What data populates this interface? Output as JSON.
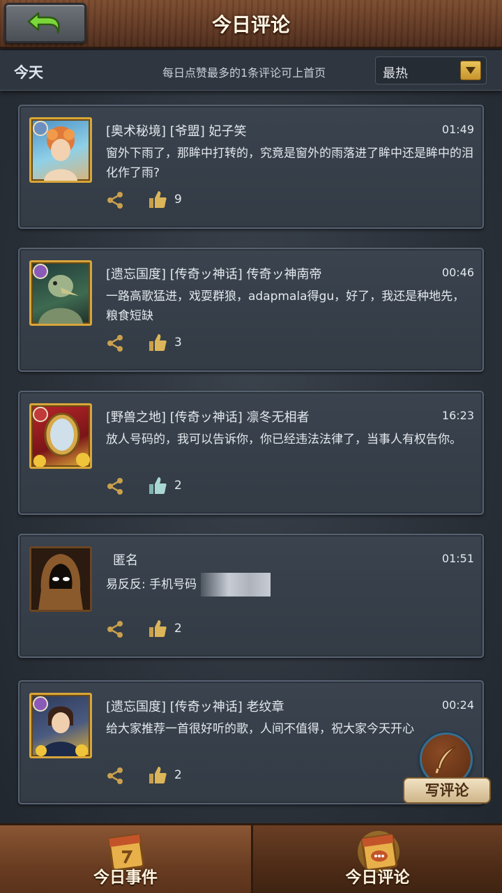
{
  "header": {
    "title": "今日评论",
    "back_icon": "back-arrow-icon"
  },
  "subbar": {
    "today_label": "今天",
    "hint": "每日点赞最多的1条评论可上首页",
    "sort": {
      "selected": "最热"
    }
  },
  "comments": [
    {
      "meta": "[奥术秘境] [爷盟] 妃子笑",
      "time": "01:49",
      "text": "窗外下雨了，那眸中打转的，究竟是窗外的雨落进了眸中还是眸中的泪化作了雨?",
      "likes": "9"
    },
    {
      "meta": "[遗忘国度] [传奇ッ神话] 传奇ッ神南帝",
      "time": "00:46",
      "text": "一路高歌猛进，戏耍群狼，adapmala得gu，好了，我还是种地先，粮食短缺",
      "likes": "3"
    },
    {
      "meta": "[野兽之地] [传奇ッ神话] 凛冬无相者",
      "time": "16:23",
      "text": "放人号码的，我可以告诉你，你已经违法法律了，当事人有权告你。",
      "likes": "2"
    },
    {
      "meta": "匿名",
      "time": "01:51",
      "text": "易反反: 手机号码",
      "likes": "2"
    },
    {
      "meta": "[遗忘国度] [传奇ッ神话] 老纹章",
      "time": "00:24",
      "text": "给大家推荐一首很好听的歌，人间不值得，祝大家今天开心",
      "likes": "2"
    }
  ],
  "write_button": {
    "label": "写评论"
  },
  "tabs": [
    {
      "label": "今日事件",
      "active": false
    },
    {
      "label": "今日评论",
      "active": true
    }
  ]
}
